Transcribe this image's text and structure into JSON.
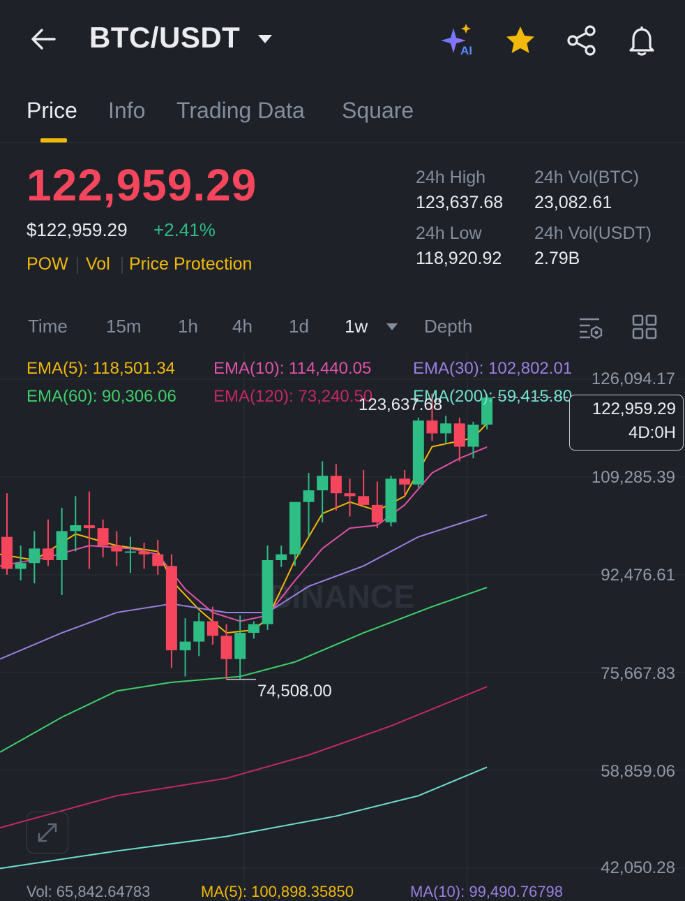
{
  "header": {
    "title": "BTC/USDT",
    "icons": [
      "back-arrow-icon",
      "chevron-down-icon",
      "ai-sparkle-icon",
      "star-icon",
      "share-icon",
      "bell-icon"
    ],
    "ai_badge": "AI"
  },
  "tabs": [
    {
      "label": "Price",
      "active": true
    },
    {
      "label": "Info",
      "active": false
    },
    {
      "label": "Trading Data",
      "active": false
    },
    {
      "label": "Square",
      "active": false
    }
  ],
  "price": {
    "last": "122,959.29",
    "usd": "$122,959.29",
    "change": "+2.41%",
    "tags": [
      "POW",
      "Vol",
      "Price Protection"
    ]
  },
  "stats": {
    "high_label": "24h High",
    "high": "123,637.68",
    "low_label": "24h Low",
    "low": "118,920.92",
    "vol_btc_label": "24h Vol(BTC)",
    "vol_btc": "23,082.61",
    "vol_usdt_label": "24h Vol(USDT)",
    "vol_usdt": "2.79B"
  },
  "intervals": [
    {
      "label": "Time",
      "active": false
    },
    {
      "label": "15m",
      "active": false
    },
    {
      "label": "1h",
      "active": false
    },
    {
      "label": "4h",
      "active": false
    },
    {
      "label": "1d",
      "active": false
    },
    {
      "label": "1w",
      "active": true
    },
    {
      "label": "Depth",
      "active": false
    }
  ],
  "colors": {
    "up": "#2ebd85",
    "down": "#f6465d",
    "accent": "#f0b90b",
    "ema5": "#f0b90b",
    "ema10": "#e052a8",
    "ema30": "#9b7fe0",
    "ema60": "#3fcf6b",
    "ema120": "#c42864",
    "ema200": "#6fe0cc"
  },
  "ema": {
    "ema5": "EMA(5): 118,501.34",
    "ema10": "EMA(10): 114,440.05",
    "ema30": "EMA(30): 102,802.01",
    "ema60": "EMA(60): 90,306.06",
    "ema120": "EMA(120): 73,240.50",
    "ema200": "EMA(200): 59,415.80"
  },
  "chart": {
    "watermark": "BINANCE",
    "axis_labels": [
      "126,094.17",
      "109,285.39",
      "92,476.61",
      "75,667.83",
      "58,859.06",
      "42,050.28"
    ],
    "current_price": "122,959.29",
    "countdown": "4D:0H",
    "high_marker": "123,637.68",
    "low_marker": "74,508.00"
  },
  "volume": {
    "vol": "Vol: 65,842.64783",
    "ma5": "MA(5): 100,898.35850",
    "ma10": "MA(10): 99,490.76798"
  },
  "chart_data": {
    "type": "candlestick",
    "y_axis_ticks": [
      126094.17,
      109285.39,
      92476.61,
      75667.83,
      58859.06,
      42050.28
    ],
    "ylim": [
      42050.28,
      126094.17
    ],
    "candles": [
      {
        "o": 99000,
        "h": 106500,
        "l": 92500,
        "c": 93500
      },
      {
        "o": 93500,
        "h": 97500,
        "l": 91500,
        "c": 94500
      },
      {
        "o": 94500,
        "h": 100000,
        "l": 91000,
        "c": 97000
      },
      {
        "o": 97000,
        "h": 102000,
        "l": 94000,
        "c": 95000
      },
      {
        "o": 95000,
        "h": 104000,
        "l": 89000,
        "c": 100000
      },
      {
        "o": 100000,
        "h": 106000,
        "l": 96500,
        "c": 101000
      },
      {
        "o": 101000,
        "h": 106800,
        "l": 93500,
        "c": 100500
      },
      {
        "o": 100500,
        "h": 102000,
        "l": 95500,
        "c": 97500
      },
      {
        "o": 97500,
        "h": 100000,
        "l": 94000,
        "c": 96500
      },
      {
        "o": 96500,
        "h": 99000,
        "l": 92800,
        "c": 96500
      },
      {
        "o": 96500,
        "h": 98000,
        "l": 93500,
        "c": 96000
      },
      {
        "o": 96000,
        "h": 98500,
        "l": 92500,
        "c": 94000
      },
      {
        "o": 94000,
        "h": 96000,
        "l": 76500,
        "c": 79500
      },
      {
        "o": 79500,
        "h": 85000,
        "l": 75000,
        "c": 81000
      },
      {
        "o": 81000,
        "h": 86000,
        "l": 78500,
        "c": 84500
      },
      {
        "o": 84500,
        "h": 87000,
        "l": 80500,
        "c": 82000
      },
      {
        "o": 82000,
        "h": 84000,
        "l": 74508,
        "c": 78000
      },
      {
        "o": 78000,
        "h": 85500,
        "l": 74508,
        "c": 82500
      },
      {
        "o": 82500,
        "h": 84500,
        "l": 81500,
        "c": 84000
      },
      {
        "o": 84000,
        "h": 97500,
        "l": 83000,
        "c": 95000
      },
      {
        "o": 95000,
        "h": 97500,
        "l": 93800,
        "c": 96000
      },
      {
        "o": 96000,
        "h": 104000,
        "l": 94000,
        "c": 105000
      },
      {
        "o": 105000,
        "h": 110000,
        "l": 99000,
        "c": 107000
      },
      {
        "o": 107000,
        "h": 112000,
        "l": 101500,
        "c": 109500
      },
      {
        "o": 109500,
        "h": 111500,
        "l": 103500,
        "c": 106500
      },
      {
        "o": 106500,
        "h": 109000,
        "l": 102500,
        "c": 106000
      },
      {
        "o": 106000,
        "h": 110500,
        "l": 104500,
        "c": 104500
      },
      {
        "o": 104500,
        "h": 108500,
        "l": 100500,
        "c": 101500
      },
      {
        "o": 101500,
        "h": 109500,
        "l": 100800,
        "c": 109000
      },
      {
        "o": 109000,
        "h": 110500,
        "l": 106000,
        "c": 108000
      },
      {
        "o": 108000,
        "h": 119500,
        "l": 107500,
        "c": 119000
      },
      {
        "o": 119000,
        "h": 123637.68,
        "l": 115500,
        "c": 116800
      },
      {
        "o": 116800,
        "h": 119800,
        "l": 115000,
        "c": 118500
      },
      {
        "o": 118500,
        "h": 119500,
        "l": 112000,
        "c": 114500
      },
      {
        "o": 114500,
        "h": 118800,
        "l": 112500,
        "c": 118300
      },
      {
        "o": 118300,
        "h": 123500,
        "l": 117500,
        "c": 122959.29
      }
    ],
    "ema_series": {
      "EMA(5)": [
        [
          0,
          96000
        ],
        [
          2,
          95000
        ],
        [
          5,
          99500
        ],
        [
          8,
          97500
        ],
        [
          11,
          96500
        ],
        [
          12,
          91500
        ],
        [
          14,
          86500
        ],
        [
          16,
          82500
        ],
        [
          18,
          83000
        ],
        [
          19,
          85000
        ],
        [
          21,
          95000
        ],
        [
          23,
          103000
        ],
        [
          25,
          105000
        ],
        [
          27,
          103500
        ],
        [
          29,
          106000
        ],
        [
          31,
          114500
        ],
        [
          34,
          116000
        ],
        [
          35,
          118501.34
        ]
      ],
      "EMA(10)": [
        [
          0,
          94000
        ],
        [
          3,
          95500
        ],
        [
          6,
          97500
        ],
        [
          9,
          97000
        ],
        [
          11,
          96000
        ],
        [
          13,
          90000
        ],
        [
          15,
          86000
        ],
        [
          17,
          84500
        ],
        [
          19,
          85500
        ],
        [
          21,
          91500
        ],
        [
          23,
          97000
        ],
        [
          25,
          100500
        ],
        [
          27,
          101000
        ],
        [
          29,
          104500
        ],
        [
          31,
          110000
        ],
        [
          33,
          112500
        ],
        [
          35,
          114440.05
        ]
      ],
      "EMA(30)": [
        [
          0,
          78000
        ],
        [
          4,
          82500
        ],
        [
          8,
          86000
        ],
        [
          12,
          87500
        ],
        [
          16,
          86000
        ],
        [
          19,
          86000
        ],
        [
          22,
          90500
        ],
        [
          26,
          94000
        ],
        [
          30,
          99000
        ],
        [
          35,
          102802.01
        ]
      ],
      "EMA(60)": [
        [
          0,
          62000
        ],
        [
          4,
          68000
        ],
        [
          8,
          72500
        ],
        [
          12,
          74000
        ],
        [
          17,
          75000
        ],
        [
          21,
          77500
        ],
        [
          26,
          82500
        ],
        [
          31,
          87000
        ],
        [
          35,
          90306.06
        ]
      ],
      "EMA(120)": [
        [
          0,
          49000
        ],
        [
          8,
          54500
        ],
        [
          16,
          57500
        ],
        [
          22,
          61500
        ],
        [
          28,
          66500
        ],
        [
          35,
          73240.5
        ]
      ],
      "EMA(200)": [
        [
          0,
          42000
        ],
        [
          8,
          45000
        ],
        [
          16,
          47500
        ],
        [
          24,
          51000
        ],
        [
          30,
          54500
        ],
        [
          35,
          59415.8
        ]
      ]
    }
  }
}
